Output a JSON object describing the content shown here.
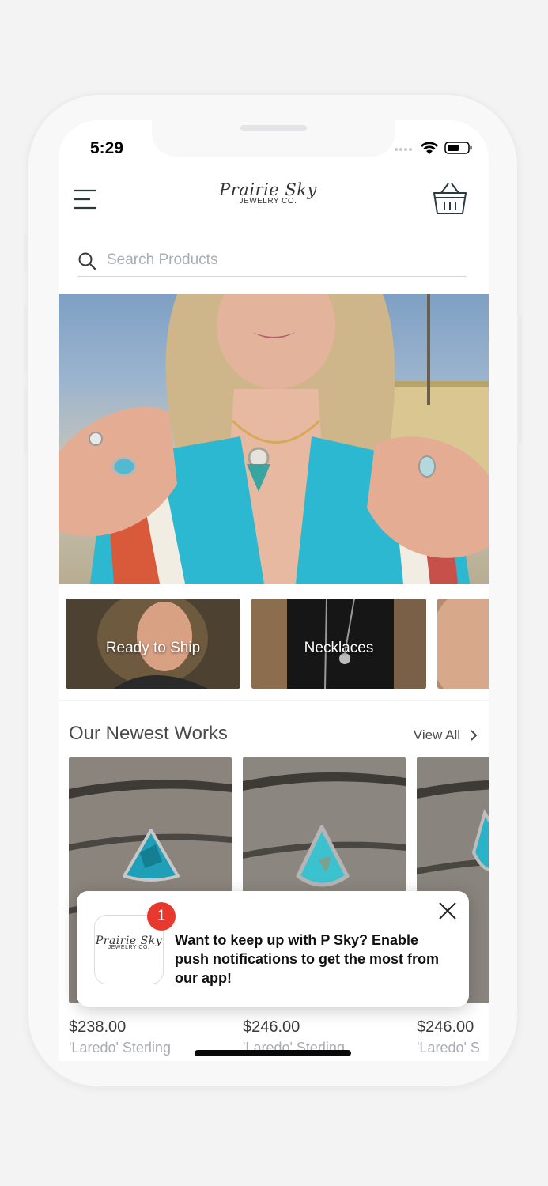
{
  "status_bar": {
    "time": "5:29"
  },
  "header": {
    "logo_line1": "Prairie Sky",
    "logo_line2": "JEWELRY CO."
  },
  "search": {
    "placeholder": "Search Products"
  },
  "categories": [
    {
      "label": "Ready to Ship"
    },
    {
      "label": "Necklaces"
    },
    {
      "label": ""
    }
  ],
  "section": {
    "title": "Our Newest Works",
    "view_all": "View All"
  },
  "products": [
    {
      "price": "$238.00",
      "name": "'Laredo' Sterling"
    },
    {
      "price": "$246.00",
      "name": "'Laredo' Sterling"
    },
    {
      "price": "$246.00",
      "name": "'Laredo' S"
    }
  ],
  "toast": {
    "badge_count": "1",
    "message": "Want to keep up with P Sky? Enable push notifications to get the most from our app!",
    "logo_line1": "Prairie Sky",
    "logo_line2": "JEWELRY CO."
  },
  "colors": {
    "badge": "#e8392e",
    "muted_text": "#a9acb4",
    "turquoise": "#2bb8d0"
  }
}
